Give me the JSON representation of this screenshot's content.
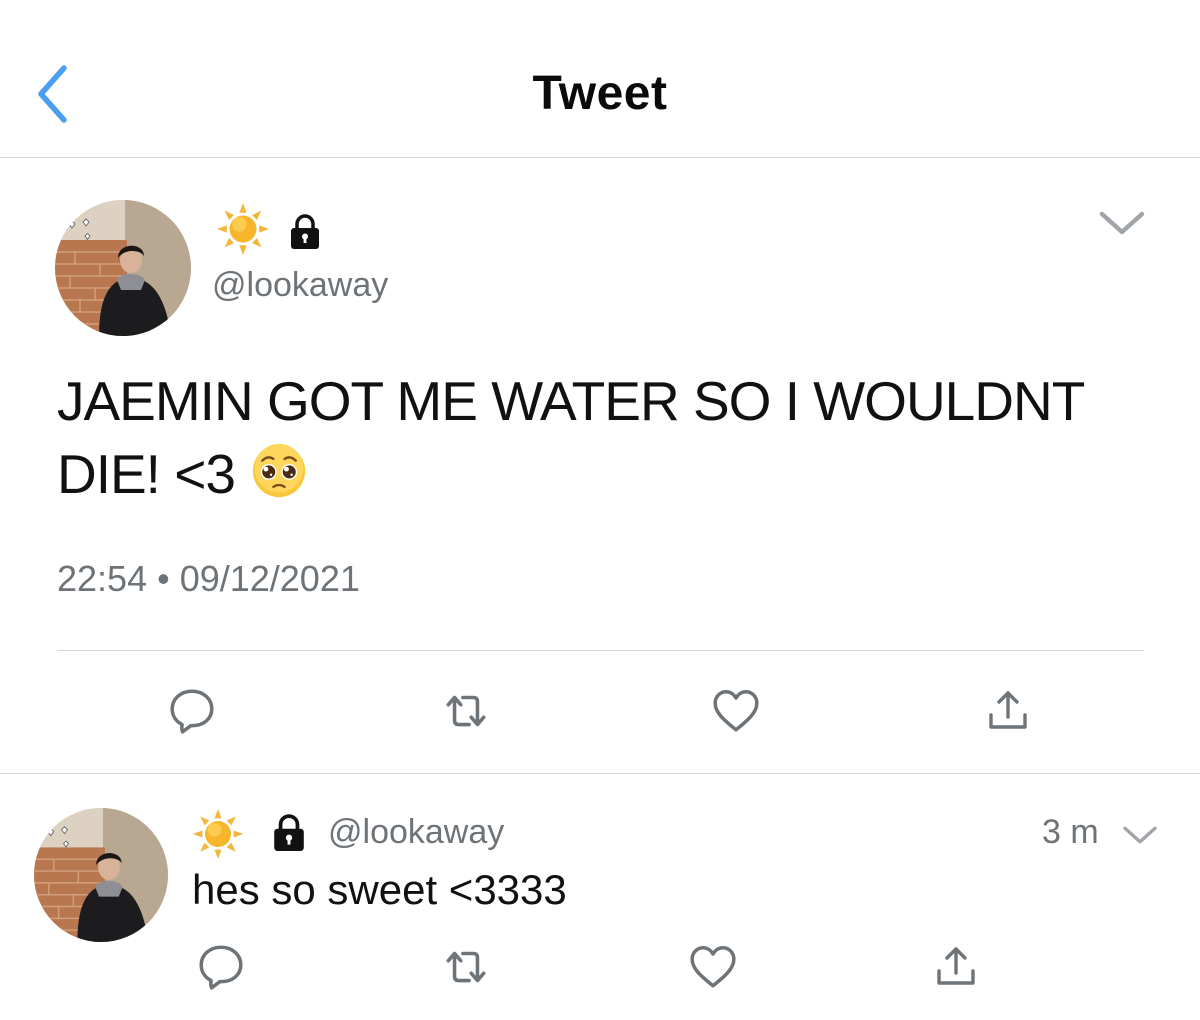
{
  "header": {
    "title": "Tweet",
    "back_icon": "chevron-left-icon"
  },
  "main_tweet": {
    "display_name_icons": [
      "sun-emoji",
      "lock-icon"
    ],
    "handle": "@lookaway",
    "text": "JAEMIN GOT ME WATER SO I WOULDNT DIE! <3",
    "emoji": "pleading-face-emoji",
    "timestamp": "22:54 • 09/12/2021",
    "actions": [
      "reply-icon",
      "retweet-icon",
      "like-icon",
      "share-icon"
    ]
  },
  "reply_tweet": {
    "display_name_icons": [
      "sun-emoji",
      "lock-icon"
    ],
    "handle": "@lookaway",
    "time": "3 m",
    "text": "hes so sweet <3333",
    "actions": [
      "reply-icon",
      "retweet-icon",
      "like-icon",
      "share-icon"
    ]
  },
  "colors": {
    "accent_blue": "#4a9ff0",
    "icon_gray": "#6e7378",
    "divider": "#d4d7da",
    "text": "#111111"
  }
}
